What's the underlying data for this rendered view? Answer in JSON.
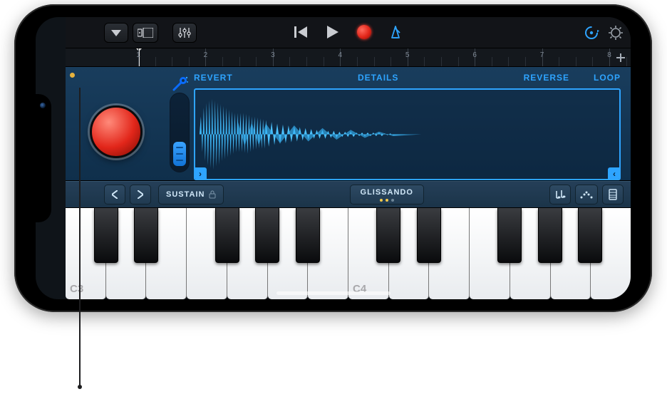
{
  "toolbar": {
    "menu": "menu",
    "tracks_view": "tracks-view",
    "mixer": "mixer",
    "prev": "go-to-beginning",
    "play": "play",
    "record": "record",
    "metronome": "metronome",
    "loop_browser": "loop-browser",
    "settings": "settings"
  },
  "ruler": {
    "bars": [
      "1",
      "2",
      "3",
      "4",
      "5",
      "6",
      "7",
      "8"
    ],
    "add": "+"
  },
  "sampler": {
    "revert_label": "REVERT",
    "details_label": "DETAILS",
    "reverse_label": "REVERSE",
    "loop_label": "LOOP",
    "shape_tool": "shape"
  },
  "kb_bar": {
    "octave_down": "‹",
    "octave_up": "›",
    "sustain_label": "SUSTAIN",
    "glissando_label": "GLISSANDO",
    "chord": "chord-strips",
    "arpeggio": "arpeggiator",
    "keyboard_layout": "keyboard-layout"
  },
  "keyboard": {
    "labels": {
      "c3": "C3",
      "c4": "C4"
    }
  },
  "colors": {
    "accent": "#2ea4ff",
    "record": "#e2261a",
    "panel": "#193d5d"
  }
}
